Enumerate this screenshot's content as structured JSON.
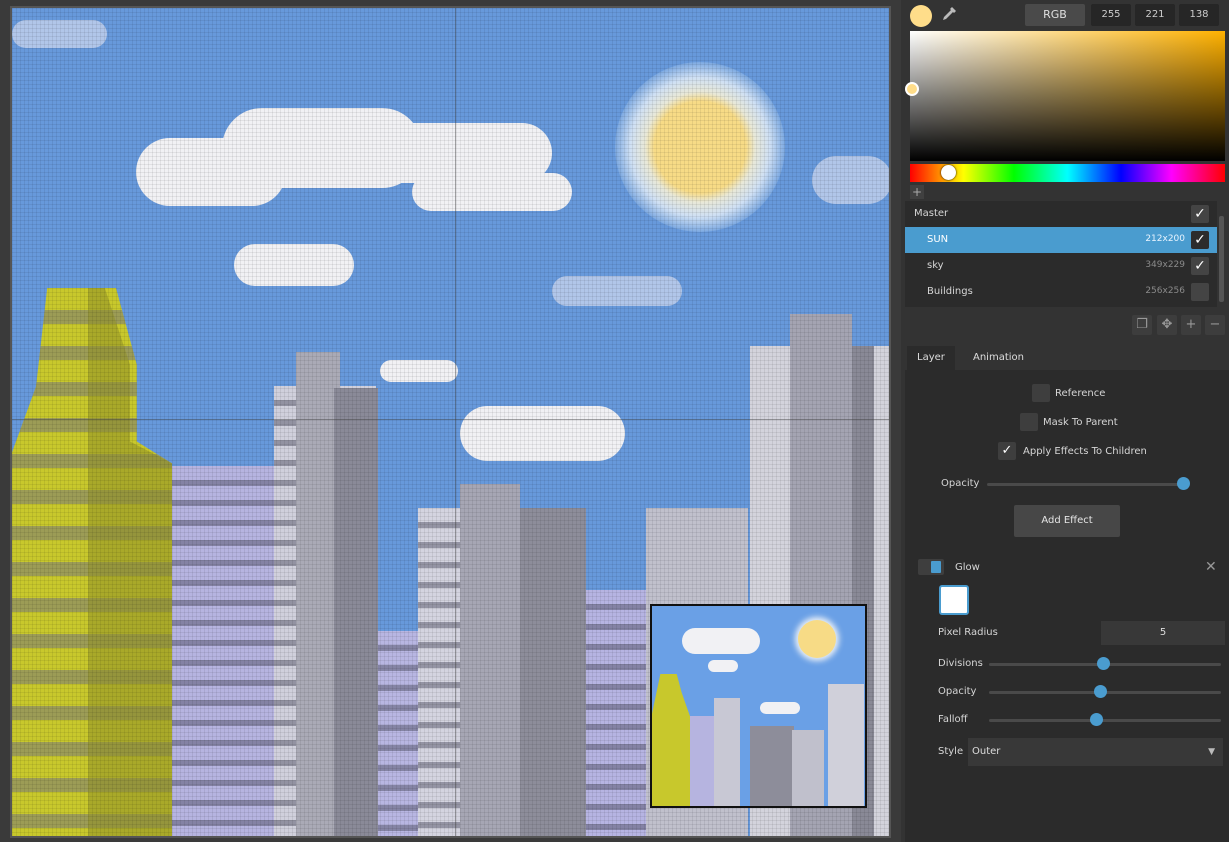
{
  "color_picker": {
    "current_color": "#ffdd8a",
    "mode_label": "RGB",
    "r": "255",
    "g": "221",
    "b": "138",
    "add_swatch": "+"
  },
  "layers": [
    {
      "name": "Master",
      "size": "",
      "checked": "✓"
    },
    {
      "name": "SUN",
      "size": "212x200",
      "checked": "✓"
    },
    {
      "name": "sky",
      "size": "349x229",
      "checked": "✓"
    },
    {
      "name": "Buildings",
      "size": "256x256",
      "checked": ""
    }
  ],
  "layer_tools": {
    "duplicate": "❐",
    "move": "✥",
    "add": "+",
    "remove": "−"
  },
  "tabs": [
    {
      "label": "Layer"
    },
    {
      "label": "Animation"
    }
  ],
  "layer_props": {
    "reference_label": "Reference",
    "mask_label": "Mask To Parent",
    "apply_fx_label": "Apply Effects To Children",
    "apply_fx_check": "✓",
    "opacity_label": "Opacity",
    "opacity_value": 1.0,
    "add_effect_label": "Add Effect"
  },
  "effect": {
    "name": "Glow",
    "close": "✕",
    "color": "#ffffff",
    "pixel_radius_label": "Pixel Radius",
    "pixel_radius_value": "5",
    "divisions_label": "Divisions",
    "divisions_value": 0.49,
    "opacity_label": "Opacity",
    "opacity_value": 0.48,
    "falloff_label": "Falloff",
    "falloff_value": 0.46,
    "style_label": "Style",
    "style_value": "Outer",
    "style_caret": "▼"
  },
  "colors": {
    "accent": "#4a9ccf",
    "sky": "#6799db",
    "sun": "#f7db86"
  }
}
